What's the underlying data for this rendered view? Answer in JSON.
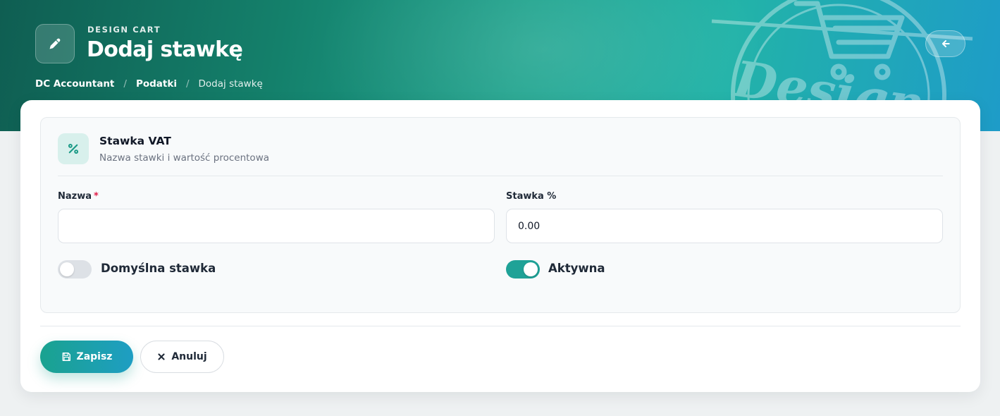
{
  "header": {
    "eyebrow": "DESIGN CART",
    "title": "Dodaj stawkę",
    "title_icon": "pencil-icon",
    "back_icon": "arrow-left-icon",
    "watermark_text": "Design"
  },
  "breadcrumb": {
    "items": [
      {
        "label": "DC Accountant"
      },
      {
        "label": "Podatki"
      },
      {
        "label": "Dodaj stawkę"
      }
    ],
    "separator": "/"
  },
  "section": {
    "icon": "percent-icon",
    "icon_glyph": "%",
    "title": "Stawka VAT",
    "subtitle": "Nazwa stawki i wartość procentowa"
  },
  "form": {
    "name_label": "Nazwa",
    "required_mark": "*",
    "name_value": "",
    "rate_label": "Stawka %",
    "rate_value": "0.00",
    "default_toggle": {
      "label": "Domyślna stawka",
      "checked": false
    },
    "active_toggle": {
      "label": "Aktywna",
      "checked": true
    }
  },
  "actions": {
    "save_label": "Zapisz",
    "save_icon": "floppy-disk-icon",
    "cancel_label": "Anuluj",
    "cancel_icon": "x-icon"
  },
  "colors": {
    "accent": "#1fa297",
    "required": "#e11d48",
    "hero_start": "#0f5e52",
    "hero_end": "#1e9cc8"
  }
}
